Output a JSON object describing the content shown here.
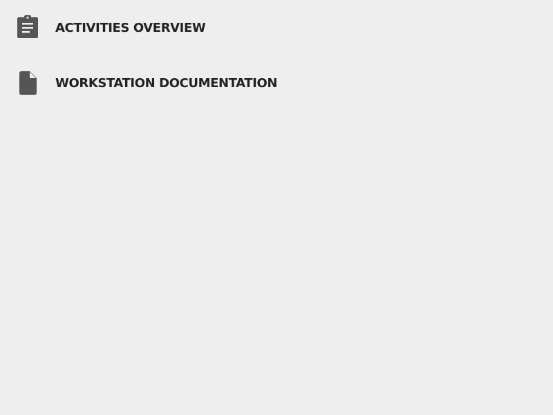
{
  "menu": {
    "items": [
      {
        "label": "ACTIVITIES OVERVIEW",
        "icon": "clipboard-list-icon"
      },
      {
        "label": "WORKSTATION DOCUMENTATION",
        "icon": "document-icon"
      }
    ]
  },
  "colors": {
    "background": "#eeeeee",
    "text": "#222222",
    "icon": "#555555"
  }
}
